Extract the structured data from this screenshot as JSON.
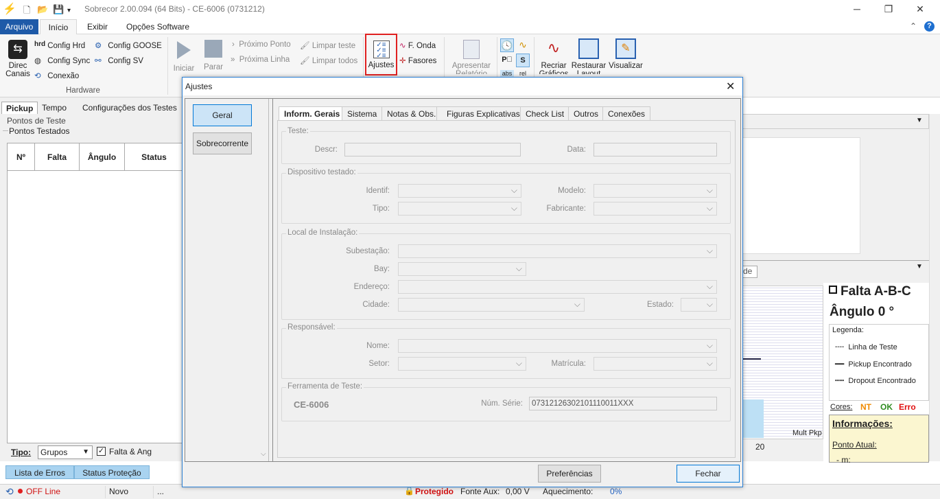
{
  "window": {
    "title": "Sobrecor 2.00.094 (64 Bits) - CE-6006 (0731212)"
  },
  "menu": {
    "tabs": [
      "Arquivo",
      "Início",
      "Exibir",
      "Opções Software"
    ]
  },
  "ribbon": {
    "direc": "Direc",
    "canais": "Canais",
    "config_hrd": "Config Hrd",
    "config_goose": "Config GOOSE",
    "config_sync": "Config Sync",
    "config_sv": "Config SV",
    "conexao": "Conexão",
    "group_hardware": "Hardware",
    "iniciar": "Iniciar",
    "parar": "Parar",
    "proximo_ponto": "Próximo Ponto",
    "proxima_linha": "Próxima Linha",
    "limpar_teste": "Limpar teste",
    "limpar_todos": "Limpar todos",
    "ajustes": "Ajustes",
    "f_onda": "F. Onda",
    "fasores": "Fasores",
    "apresentar": "Apresentar",
    "relatorio": "Relatório",
    "abs": "abs",
    "rel": "rel",
    "recriar": "Recriar",
    "graficos": "Gráficos",
    "restaurar": "Restaurar",
    "layout": "Layout",
    "visualizar": "Visualizar"
  },
  "left": {
    "tabs": [
      "Pickup",
      "Tempo",
      "Configurações dos Testes"
    ],
    "pontos_de_teste": "Pontos de Teste",
    "pontos_testados": "Pontos Testados",
    "cols": [
      "Nº",
      "Falta",
      "Ângulo",
      "Status"
    ],
    "tipo_label": "Tipo:",
    "tipo_value": "Grupos",
    "falta_ang": "Falta & Ang",
    "bottom_tabs": [
      "Lista de Erros",
      "Status Proteção"
    ]
  },
  "right": {
    "tab_fragment": "de",
    "falta": "Falta A-B-C",
    "angulo": "Ângulo 0 °",
    "legenda": "Legenda:",
    "linha_teste": "Linha de Teste",
    "pickup_enc": "Pickup Encontrado",
    "dropout_enc": "Dropout Encontrado",
    "cores": "Cores:",
    "nt": "NT",
    "ok": "OK",
    "erro": "Erro",
    "info": "Informações:",
    "ponto_atual": "Ponto Atual:",
    "m": "- m:",
    "mult_pkp": "Mult Pkp",
    "x20": "20"
  },
  "status": {
    "offline": "OFF Line",
    "novo": "Novo",
    "dots": "...",
    "protegido": "Protegido",
    "fonte_aux": "Fonte Aux:",
    "fonte_val": "0,00 V",
    "aquec": "Aquecimento:",
    "aquec_val": "0%"
  },
  "dialog": {
    "title": "Ajustes",
    "left_buttons": [
      "Geral",
      "Sobrecorrente"
    ],
    "tabs": [
      "Inform. Gerais",
      "Sistema",
      "Notas & Obs.",
      "Figuras Explicativas",
      "Check List",
      "Outros",
      "Conexões"
    ],
    "g_teste": "Teste:",
    "descr": "Descr:",
    "data": "Data:",
    "g_disp": "Dispositivo testado:",
    "identif": "Identif:",
    "modelo": "Modelo:",
    "tipo": "Tipo:",
    "fabricante": "Fabricante:",
    "g_local": "Local de Instalação:",
    "subestacao": "Subestação:",
    "bay": "Bay:",
    "endereco": "Endereço:",
    "cidade": "Cidade:",
    "estado": "Estado:",
    "g_resp": "Responsável:",
    "nome": "Nome:",
    "setor": "Setor:",
    "matricula": "Matrícula:",
    "g_ferr": "Ferramenta de Teste:",
    "ferr_name": "CE-6006",
    "num_serie": "Núm. Série:",
    "num_serie_val": "07312126302101110011XXX",
    "preferencias": "Preferências",
    "fechar": "Fechar"
  },
  "colors": {
    "accent": "#1e5aa8",
    "highlight": "#e02020",
    "nt": "#f08a00",
    "ok": "#2e8b20",
    "erro": "#e01010"
  }
}
